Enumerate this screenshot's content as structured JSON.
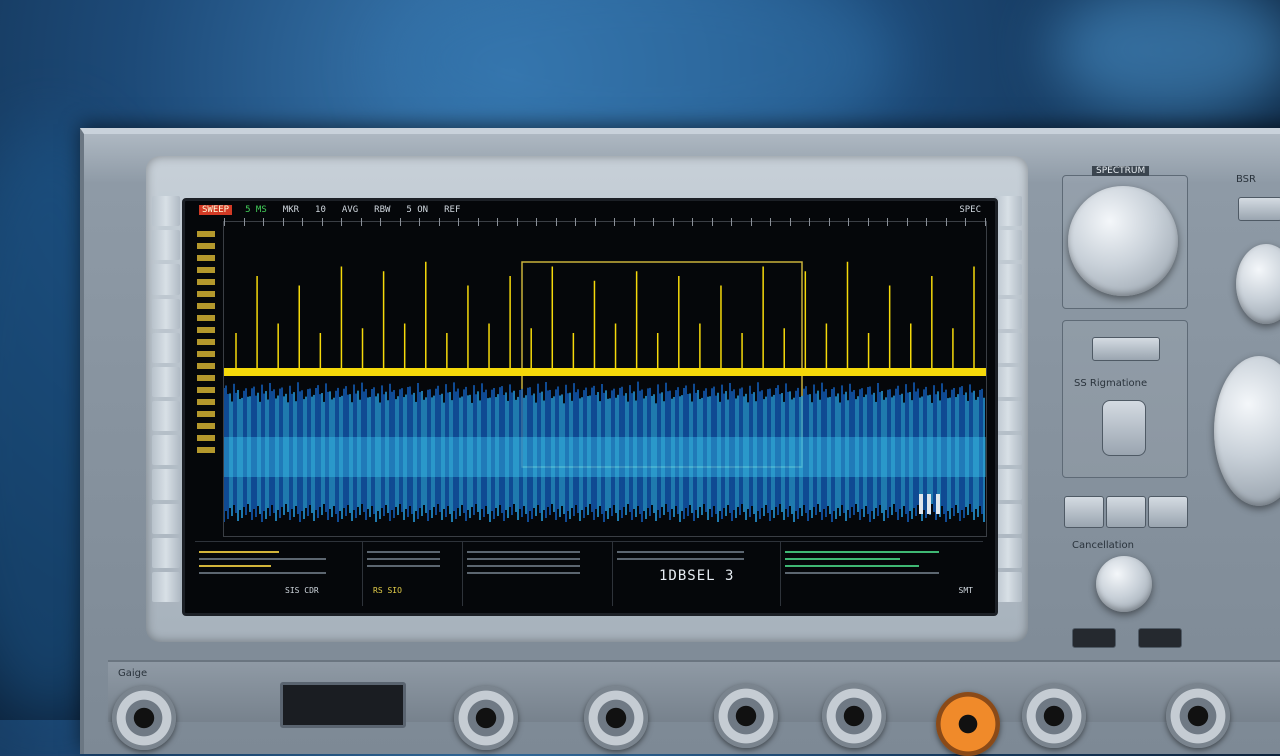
{
  "screen": {
    "top_labels": [
      "SWEEP",
      "5 MS",
      "MKR",
      "10",
      "AVG",
      "RBW",
      "5 ON",
      "REF"
    ],
    "top_right": "SPEC",
    "readout": "1DBSEL 3",
    "softkeys": [
      {
        "title": "",
        "value": "SIS CDR"
      },
      {
        "title": "",
        "value": "RS SIO"
      },
      {
        "title": "",
        "value": ""
      },
      {
        "title": "",
        "value": ""
      },
      {
        "title": "",
        "value": "SMT"
      }
    ]
  },
  "panel": {
    "knob1_label": "SPECTRUM",
    "right_label": "BSR",
    "mid_label": "SS Rigmatione",
    "bottom_label": "Cancellation",
    "left_bottom_label": "Gaige"
  },
  "chart_data": {
    "type": "line",
    "series": [
      {
        "values": [
          0.2,
          0.8,
          0.3,
          0.7,
          0.2,
          0.9,
          0.25,
          0.85,
          0.3,
          0.95,
          0.2,
          0.7,
          0.3,
          0.8,
          0.25,
          0.9,
          0.2,
          0.75,
          0.3,
          0.85
        ]
      },
      {
        "values": [
          0.1,
          0.4,
          0.15,
          0.35,
          0.12,
          0.38,
          0.1,
          0.42,
          0.14,
          0.37
        ]
      }
    ],
    "colors": {
      "trace1": "#f5d90a",
      "trace2": "#1e8fe0"
    }
  }
}
